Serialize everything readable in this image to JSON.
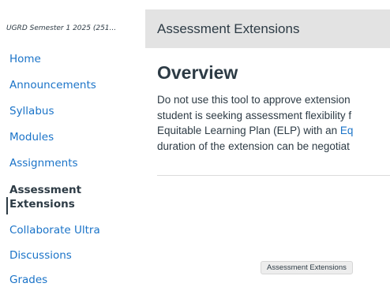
{
  "sidebar": {
    "course_title": "UGRD Semester 1 2025 (251...",
    "items": [
      {
        "label": "Home"
      },
      {
        "label": "Announcements"
      },
      {
        "label": "Syllabus"
      },
      {
        "label": "Modules"
      },
      {
        "label": "Assignments"
      },
      {
        "label": "Assessment Extensions",
        "active": true
      },
      {
        "label": "Collaborate Ultra"
      },
      {
        "label": "Discussions"
      },
      {
        "label": "Grades"
      }
    ]
  },
  "header": {
    "title": "Assessment Extensions"
  },
  "main": {
    "heading": "Overview",
    "lines": [
      "Do not use this tool to approve extension",
      "student is seeking assessment flexibility f",
      "Equitable Learning Plan (ELP) with an ",
      "duration of the extension can be negotiat"
    ],
    "inline_link": "Eq"
  },
  "tooltip": {
    "text": "Assessment Extensions"
  },
  "colors": {
    "link": "#1a73c8",
    "text": "#2d3b45",
    "header_bg": "#e3e3e3"
  }
}
